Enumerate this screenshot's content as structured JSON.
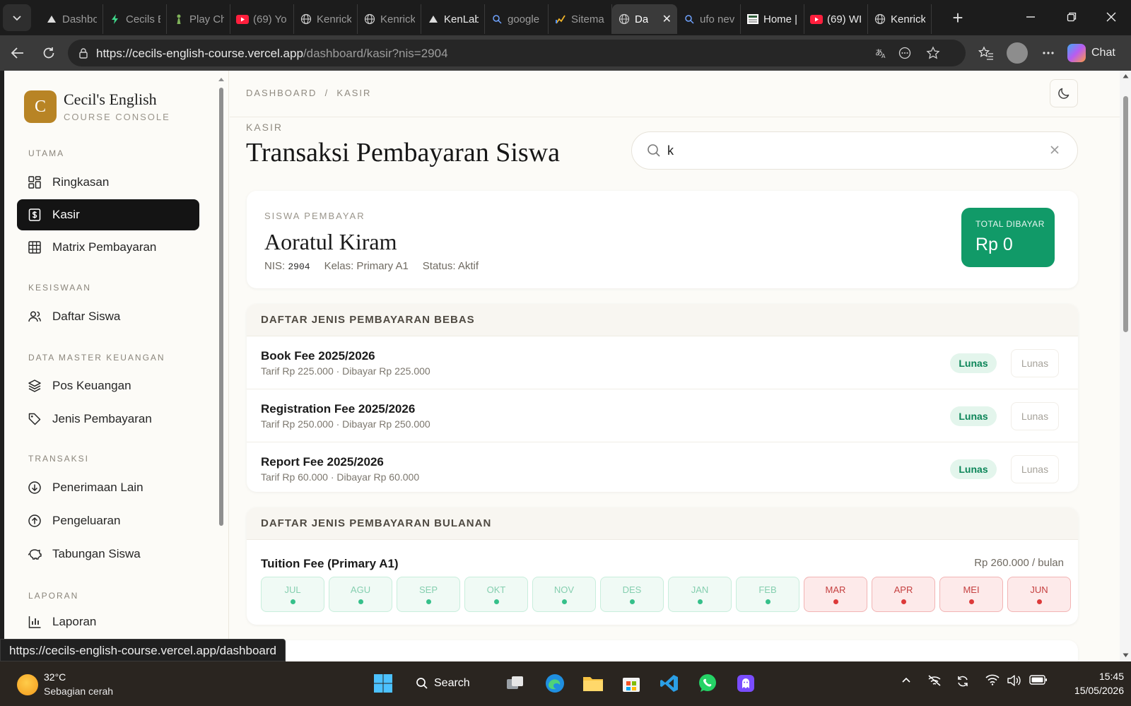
{
  "browser": {
    "tabs": [
      {
        "label": "Dashbo",
        "icon": "vercel-icon"
      },
      {
        "label": "Cecils E",
        "icon": "bolt-icon"
      },
      {
        "label": "Play Ch",
        "icon": "chess-pawn-icon"
      },
      {
        "label": "(69) Yo",
        "icon": "youtube-icon"
      },
      {
        "label": "Kenrick",
        "icon": "globe-icon"
      },
      {
        "label": "Kenrick",
        "icon": "globe-icon"
      },
      {
        "label": "KenLab",
        "icon": "vercel-icon"
      },
      {
        "label": "google",
        "icon": "search-icon"
      },
      {
        "label": "Sitema",
        "icon": "chart-icon"
      },
      {
        "label": "Da",
        "icon": "globe-icon",
        "active": true
      },
      {
        "label": "ufo nev",
        "icon": "search-icon"
      },
      {
        "label": "Home |",
        "icon": "news-icon"
      },
      {
        "label": "(69) WI",
        "icon": "youtube-icon"
      },
      {
        "label": "Kenrick",
        "icon": "globe-icon"
      }
    ],
    "url_host": "https://cecils-english-course.vercel.app",
    "url_path": "/dashboard/kasir?nis=2904",
    "chat_label": "Chat",
    "status_url": "https://cecils-english-course.vercel.app/dashboard"
  },
  "sidebar": {
    "brand_initial": "C",
    "brand_name": "Cecil's English",
    "brand_sub": "COURSE CONSOLE",
    "sections": {
      "utama": "UTAMA",
      "kesiswaan": "KESISWAAN",
      "keuangan": "DATA MASTER KEUANGAN",
      "transaksi": "TRANSAKSI",
      "laporan": "LAPORAN"
    },
    "items": {
      "ringkasan": "Ringkasan",
      "kasir": "Kasir",
      "matrix": "Matrix Pembayaran",
      "daftar_siswa": "Daftar Siswa",
      "pos_keuangan": "Pos Keuangan",
      "jenis_pembayaran": "Jenis Pembayaran",
      "penerimaan_lain": "Penerimaan Lain",
      "pengeluaran": "Pengeluaran",
      "tabungan_siswa": "Tabungan Siswa",
      "laporan": "Laporan"
    }
  },
  "header": {
    "breadcrumb": "DASHBOARD  /  KASIR",
    "eyebrow": "KASIR",
    "title": "Transaksi Pembayaran Siswa",
    "search_value": "k"
  },
  "student": {
    "label": "SISWA PEMBAYAR",
    "name": "Aoratul Kiram",
    "nis_label": "NIS:",
    "nis": "2904",
    "kelas": "Kelas: Primary A1",
    "status": "Status: Aktif",
    "total_label": "TOTAL DIBAYAR",
    "total_value": "Rp 0"
  },
  "bebas": {
    "title": "DAFTAR JENIS PEMBAYARAN BEBAS",
    "rows": [
      {
        "name": "Book Fee 2025/2026",
        "sub": "Tarif Rp 225.000 · Dibayar Rp 225.000",
        "badge": "Lunas",
        "action": "Lunas"
      },
      {
        "name": "Registration Fee 2025/2026",
        "sub": "Tarif Rp 250.000 · Dibayar Rp 250.000",
        "badge": "Lunas",
        "action": "Lunas"
      },
      {
        "name": "Report Fee 2025/2026",
        "sub": "Tarif Rp 60.000 · Dibayar Rp 60.000",
        "badge": "Lunas",
        "action": "Lunas"
      }
    ]
  },
  "bulanan": {
    "title": "DAFTAR JENIS PEMBAYARAN BULANAN",
    "fee_name": "Tuition Fee (Primary A1)",
    "fee_price": "Rp 260.000 / bulan",
    "months": [
      {
        "label": "JUL",
        "status": "paid"
      },
      {
        "label": "AGU",
        "status": "paid"
      },
      {
        "label": "SEP",
        "status": "paid"
      },
      {
        "label": "OKT",
        "status": "paid"
      },
      {
        "label": "NOV",
        "status": "paid"
      },
      {
        "label": "DES",
        "status": "paid"
      },
      {
        "label": "JAN",
        "status": "paid"
      },
      {
        "label": "FEB",
        "status": "paid"
      },
      {
        "label": "MAR",
        "status": "unpaid"
      },
      {
        "label": "APR",
        "status": "unpaid"
      },
      {
        "label": "MEI",
        "status": "unpaid"
      },
      {
        "label": "JUN",
        "status": "unpaid"
      }
    ]
  },
  "taskbar": {
    "temp": "32°C",
    "weather": "Sebagian cerah",
    "search_label": "Search",
    "time": "15:45",
    "date": "15/05/2026"
  },
  "colors": {
    "accent_dark": "#141414",
    "brand_gold": "#b88425",
    "paid_green": "#119a68",
    "unpaid_red": "#dd3a3a"
  }
}
